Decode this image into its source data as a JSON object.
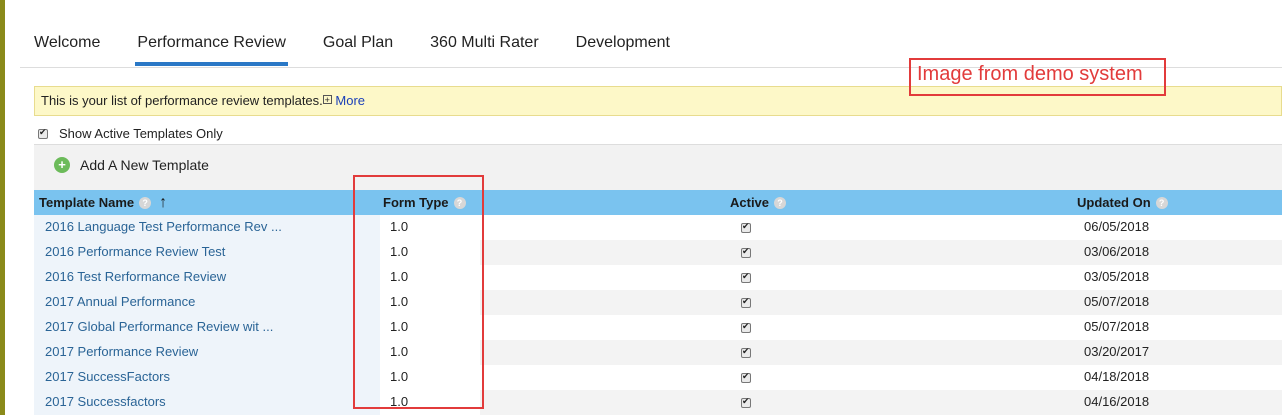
{
  "tabs": [
    "Welcome",
    "Performance Review",
    "Goal Plan",
    "360 Multi Rater",
    "Development"
  ],
  "info": {
    "text": "This is your list of performance review templates.",
    "expand_icon": "plus-box-icon",
    "more": "More"
  },
  "filter": {
    "label": "Show Active Templates Only",
    "checked": true
  },
  "toolbar": {
    "add_label": "Add A New Template",
    "add_icon": "green-plus-circle-icon"
  },
  "table": {
    "headers": {
      "name": "Template Name",
      "form": "Form Type",
      "active": "Active",
      "updated": "Updated On"
    },
    "rows": [
      {
        "name": "2016 Language Test Performance Rev ...",
        "form": "1.0",
        "active": true,
        "updated": "06/05/2018"
      },
      {
        "name": "2016 Performance Review Test",
        "form": "1.0",
        "active": true,
        "updated": "03/06/2018"
      },
      {
        "name": "2016 Test Rerformance Review",
        "form": "1.0",
        "active": true,
        "updated": "03/05/2018"
      },
      {
        "name": "2017 Annual Performance",
        "form": "1.0",
        "active": true,
        "updated": "05/07/2018"
      },
      {
        "name": "2017 Global Performance Review wit ...",
        "form": "1.0",
        "active": true,
        "updated": "05/07/2018"
      },
      {
        "name": "2017 Performance Review",
        "form": "1.0",
        "active": true,
        "updated": "03/20/2017"
      },
      {
        "name": "2017 SuccessFactors",
        "form": "1.0",
        "active": true,
        "updated": "04/18/2018"
      },
      {
        "name": "2017 Successfactors",
        "form": "1.0",
        "active": true,
        "updated": "04/16/2018"
      }
    ]
  },
  "annotation": {
    "text": "Image from demo system",
    "color": "#e23b3b"
  },
  "colors": {
    "accent": "#2a78c6",
    "header_bg": "#7ac3ef",
    "info_bg": "#fdf8c8",
    "link": "#2a6496"
  }
}
